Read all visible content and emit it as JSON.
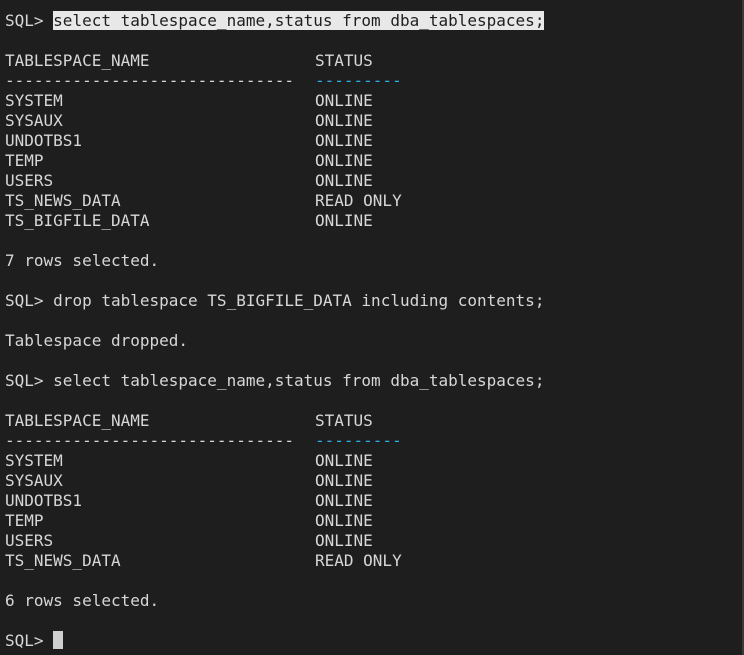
{
  "terminal": {
    "prompt": "SQL> ",
    "blocks": {
      "q1": {
        "command": "select tablespace_name,status from dba_tablespaces;",
        "header_name": "TABLESPACE_NAME",
        "header_status": "STATUS",
        "dash_name": "------------------------------",
        "dash_status": "---------",
        "rows": [
          {
            "name": "SYSTEM",
            "status": "ONLINE"
          },
          {
            "name": "SYSAUX",
            "status": "ONLINE"
          },
          {
            "name": "UNDOTBS1",
            "status": "ONLINE"
          },
          {
            "name": "TEMP",
            "status": "ONLINE"
          },
          {
            "name": "USERS",
            "status": "ONLINE"
          },
          {
            "name": "TS_NEWS_DATA",
            "status": "READ ONLY"
          },
          {
            "name": "TS_BIGFILE_DATA",
            "status": "ONLINE"
          }
        ],
        "summary": "7 rows selected."
      },
      "drop": {
        "command": "drop tablespace TS_BIGFILE_DATA including contents;",
        "result": "Tablespace dropped."
      },
      "q2": {
        "command": "select tablespace_name,status from dba_tablespaces;",
        "header_name": "TABLESPACE_NAME",
        "header_status": "STATUS",
        "dash_name": "------------------------------",
        "dash_status": "---------",
        "rows": [
          {
            "name": "SYSTEM",
            "status": "ONLINE"
          },
          {
            "name": "SYSAUX",
            "status": "ONLINE"
          },
          {
            "name": "UNDOTBS1",
            "status": "ONLINE"
          },
          {
            "name": "TEMP",
            "status": "ONLINE"
          },
          {
            "name": "USERS",
            "status": "ONLINE"
          },
          {
            "name": "TS_NEWS_DATA",
            "status": "READ ONLY"
          }
        ],
        "summary": "6 rows selected."
      }
    },
    "colors": {
      "background": "#1e1e1e",
      "text": "#d7d7d7",
      "status_dashes": "#2ab0e8",
      "selection": "#e8e8e8"
    }
  }
}
